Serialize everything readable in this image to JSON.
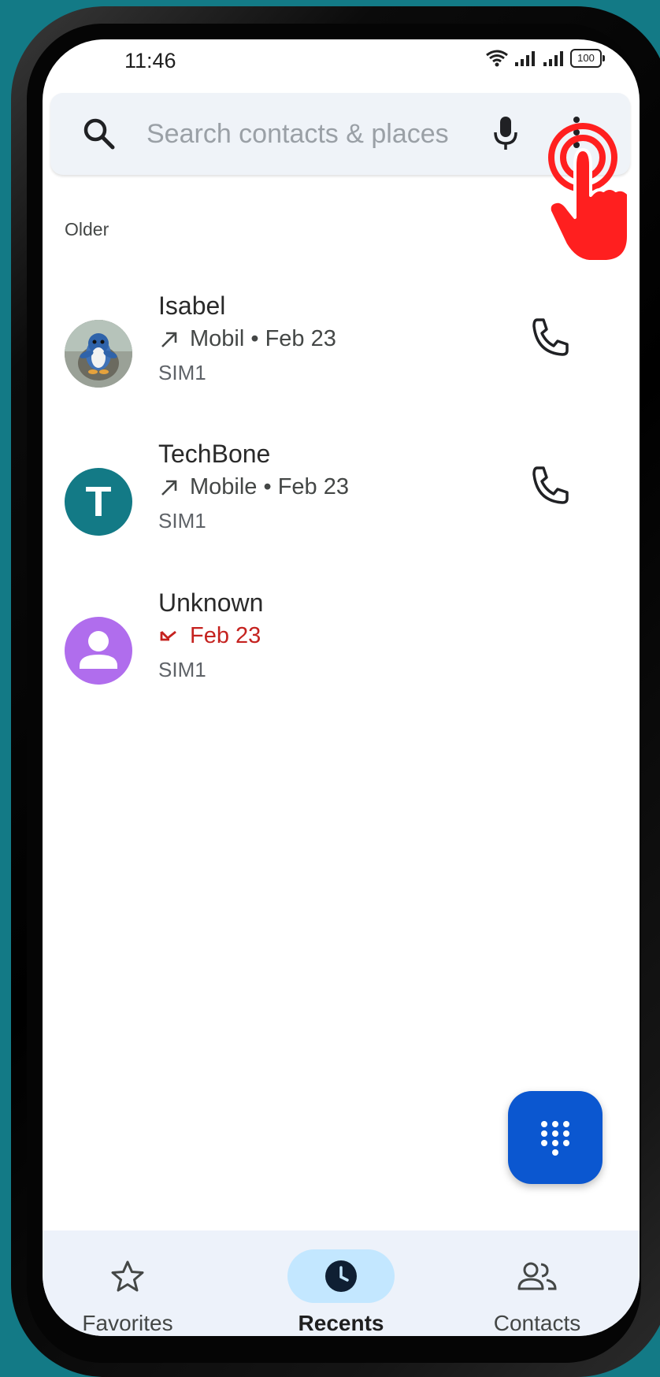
{
  "status_bar": {
    "time": "11:46",
    "battery": "100"
  },
  "search": {
    "placeholder": "Search contacts & places"
  },
  "section_header": "Older",
  "calls": [
    {
      "name": "Isabel",
      "detail": "Mobil • Feb 23",
      "sim": "SIM1",
      "direction": "outgoing"
    },
    {
      "name": "TechBone",
      "detail": "Mobile • Feb 23",
      "sim": "SIM1",
      "direction": "outgoing",
      "avatar_letter": "T",
      "avatar_color": "#137a86"
    },
    {
      "name": "Unknown",
      "detail": "Feb 23",
      "sim": "SIM1",
      "direction": "missed",
      "avatar_color": "#b06ded"
    }
  ],
  "nav": [
    {
      "label": "Favorites",
      "icon": "star-icon"
    },
    {
      "label": "Recents",
      "icon": "clock-icon",
      "active": true
    },
    {
      "label": "Contacts",
      "icon": "people-icon"
    }
  ],
  "colors": {
    "accent": "#0b57d0",
    "missed": "#c5221f",
    "tap_indicator": "#ff1f1f"
  }
}
